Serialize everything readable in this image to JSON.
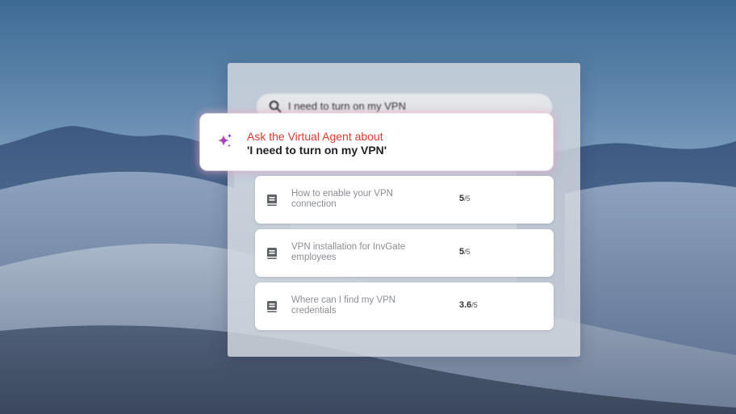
{
  "search": {
    "query": "I need to turn on my VPN"
  },
  "virtual_agent": {
    "title": "Ask the Virtual Agent about",
    "query": "'I need to turn on my VPN'"
  },
  "results": [
    {
      "title": "How to enable your VPN connection",
      "rating": "5",
      "rating_max": "/5"
    },
    {
      "title": "VPN installation for InvGate employees",
      "rating": "5",
      "rating_max": "/5"
    },
    {
      "title": "Where can I find my VPN credentials",
      "rating": "3.6",
      "rating_max": "/5"
    }
  ],
  "colors": {
    "accent_red": "#d53a33",
    "sparkle_purple": "#7b3fe4",
    "sparkle_pink": "#e0458f"
  },
  "icons": {
    "search": "search-icon",
    "virtual_agent": "sparkle-icon",
    "article": "document-icon"
  }
}
